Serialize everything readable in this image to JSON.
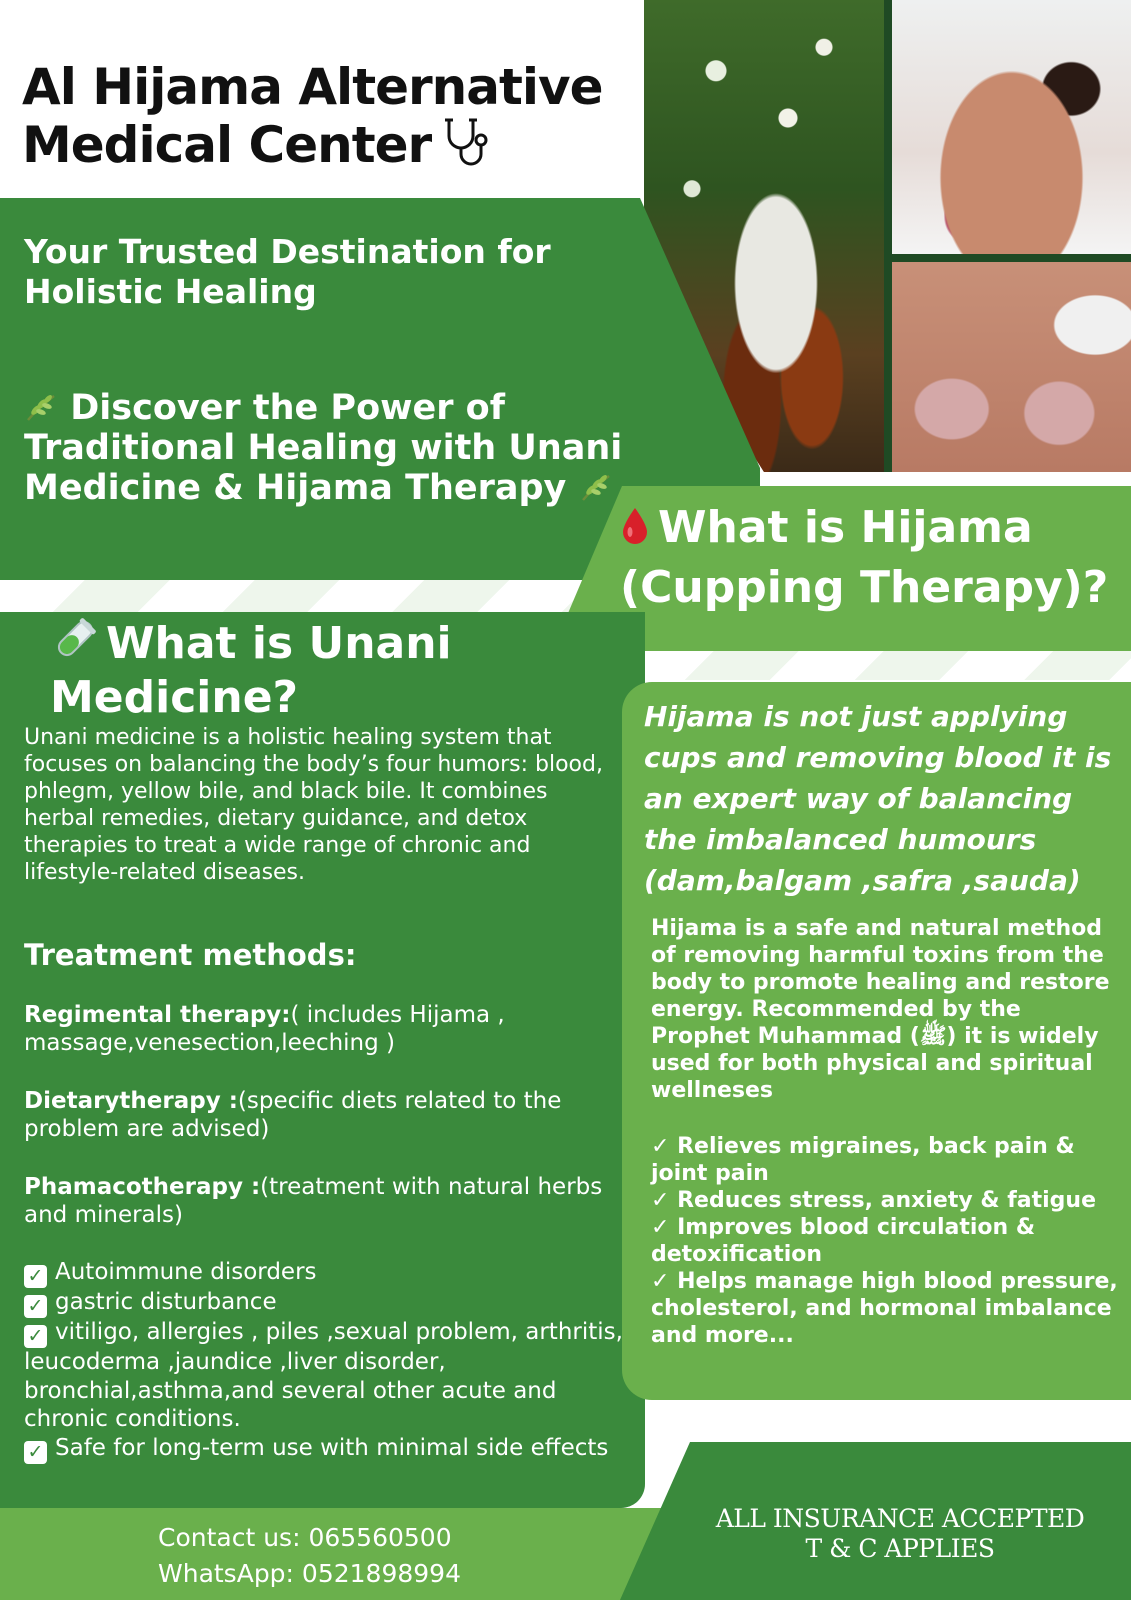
{
  "header": {
    "title_line1": "Al Hijama Alternative",
    "title_line2": "Medical Center"
  },
  "hero": {
    "tagline": "Your Trusted Destination for Holistic Healing",
    "discover": "Discover the Power of Traditional Healing with Unani Medicine & Hijama Therapy"
  },
  "hijama": {
    "heading": "What is Hijama (Cupping Therapy)?",
    "quote": "Hijama is not just applying cups and removing blood it is an expert way of balancing the imbalanced humours (dam,balgam ,safra ,sauda)",
    "description": "Hijama is a safe and natural method of removing harmful toxins from the body to promote healing and restore energy. Recommended by the Prophet Muhammad (ﷺ) it is widely used for both physical and spiritual wellneses",
    "benefits": [
      "✓ Relieves migraines, back pain & joint pain",
      "✓ Reduces stress, anxiety & fatigue",
      "✓ Improves blood circulation & detoxification",
      "✓ Helps manage high blood pressure, cholesterol, and hormonal imbalance and more..."
    ]
  },
  "unani": {
    "heading": "What is Unani Medicine?",
    "description": "Unani medicine is a holistic healing system that focuses on balancing the body’s four humors: blood, phlegm, yellow bile, and black bile. It combines herbal remedies, dietary guidance, and detox therapies to treat a wide range of chronic and lifestyle-related diseases.",
    "treatment_title": "Treatment methods:",
    "methods": [
      {
        "name": "Regimental therapy:",
        "detail": "( includes Hijama , massage,venesection,leeching )"
      },
      {
        "name": "Dietarytherapy :",
        "detail": "(specific diets related to the problem are advised)"
      },
      {
        "name": "Phamacotherapy :",
        "detail": "(treatment with natural herbs and minerals)"
      }
    ],
    "benefits": [
      "Autoimmune disorders",
      "gastric disturbance",
      "vitiligo, allergies , piles ,sexual problem, arthritis, leucoderma ,jaundice ,liver disorder, bronchial,asthma,and several other acute and chronic conditions.",
      "Safe for long-term use with minimal side effects"
    ]
  },
  "footer": {
    "contact": "Contact us: 065560500",
    "whatsapp": "WhatsApp: 0521898994",
    "insurance_line1": "ALL INSURANCE ACCEPTED",
    "insurance_line2": "T & C  APPLIES"
  },
  "icons": {
    "title_icon": "stethoscope-icon",
    "discover_icon": "herb-leaf-icon",
    "hijama_icon": "blood-drop-icon",
    "unani_icon": "test-tube-icon",
    "benefit_icon": "check-box-icon"
  },
  "colors": {
    "dark_green": "#3a8a3c",
    "light_green": "#6ab04c",
    "title_text": "#111111"
  }
}
